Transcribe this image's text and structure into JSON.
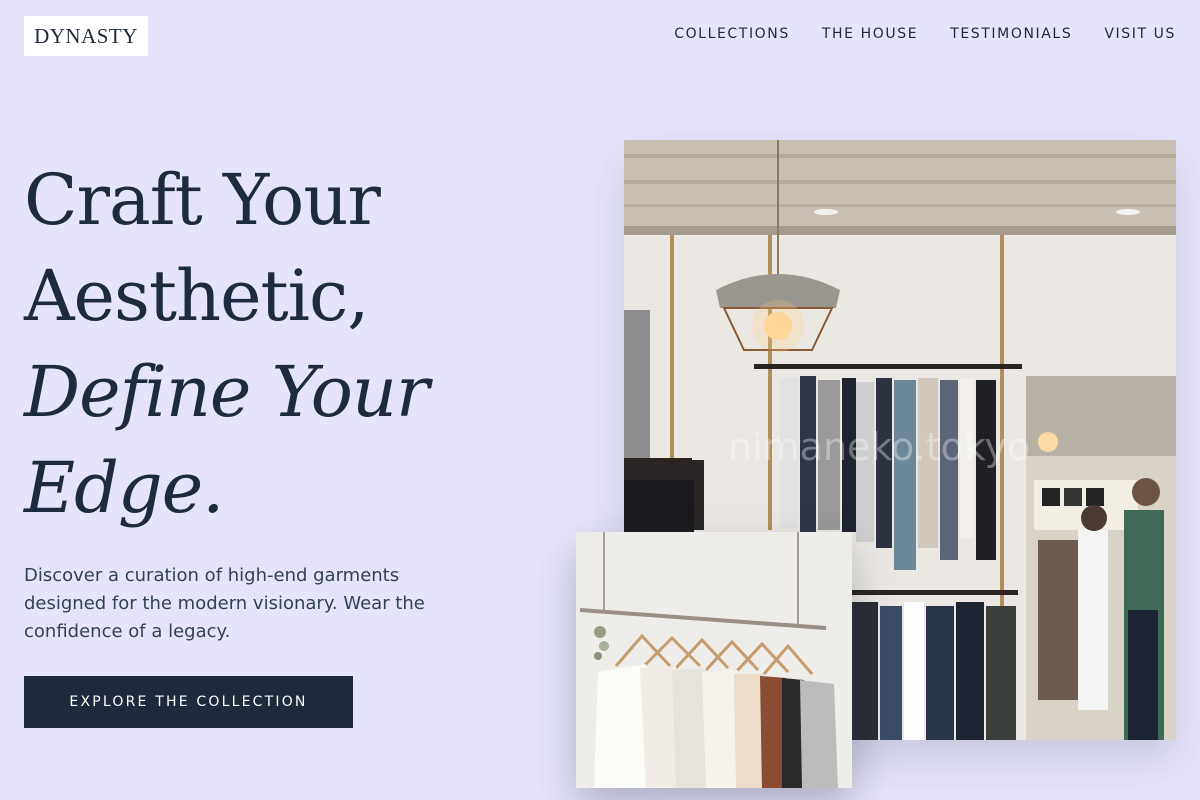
{
  "brand": {
    "logo_text": "DYNASTY"
  },
  "nav": {
    "items": [
      {
        "label": "COLLECTIONS"
      },
      {
        "label": "THE HOUSE"
      },
      {
        "label": "TESTIMONIALS"
      },
      {
        "label": "VISIT US"
      }
    ]
  },
  "hero": {
    "headline_line1": "Craft Your",
    "headline_line2": "Aesthetic,",
    "headline_line3": "Define Your",
    "headline_line4": "Edge.",
    "description": "Discover a curation of high-end garments designed for the modern visionary. Wear the confidence of a legacy.",
    "cta_label": "EXPLORE THE COLLECTION"
  },
  "images": {
    "main_alt": "Boutique interior with hanging rope lamp and clothing racks",
    "main_watermark": "nimaneko.tokyo",
    "inset_alt": "Row of neutral-toned blouses on wooden hangers"
  },
  "colors": {
    "background": "#e6e4fa",
    "ink": "#1e293b",
    "button": "#1e293b"
  }
}
